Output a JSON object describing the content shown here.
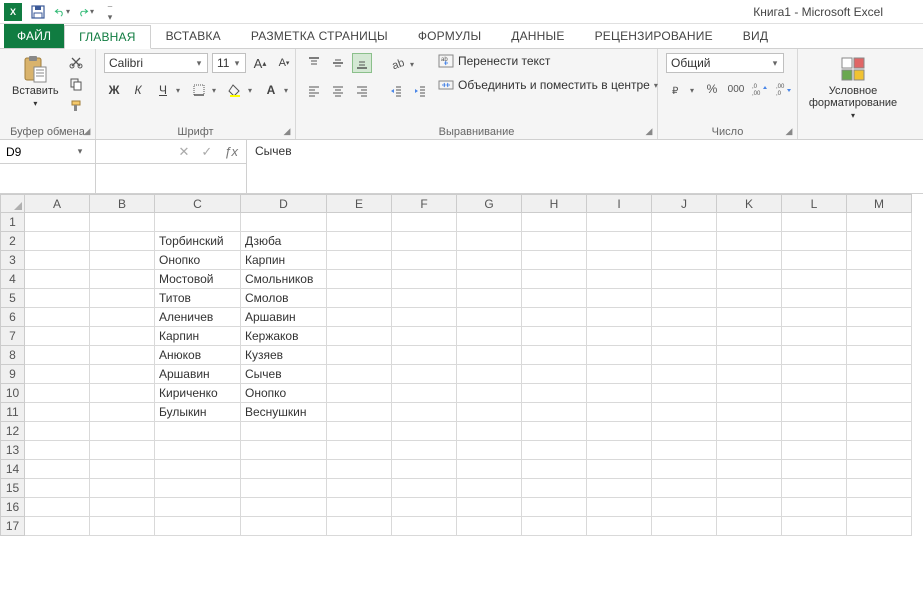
{
  "app": {
    "title": "Книга1 - Microsoft Excel"
  },
  "qat": {
    "save": "save-icon",
    "undo": "undo-icon",
    "redo": "redo-icon"
  },
  "tabs": {
    "file": "ФАЙЛ",
    "items": [
      "ГЛАВНАЯ",
      "ВСТАВКА",
      "РАЗМЕТКА СТРАНИЦЫ",
      "ФОРМУЛЫ",
      "ДАННЫЕ",
      "РЕЦЕНЗИРОВАНИЕ",
      "ВИД"
    ],
    "active_index": 0
  },
  "ribbon": {
    "clipboard": {
      "label": "Буфер обмена",
      "paste": "Вставить"
    },
    "font": {
      "label": "Шрифт",
      "name": "Calibri",
      "size": "11"
    },
    "alignment": {
      "label": "Выравнивание",
      "wrap": "Перенести текст",
      "merge": "Объединить и поместить в центре"
    },
    "number": {
      "label": "Число",
      "format": "Общий"
    },
    "styles": {
      "label": "Условное",
      "label2": "форматирование"
    }
  },
  "namebox": {
    "value": "D9"
  },
  "formula": {
    "value": "Сычев"
  },
  "columns": [
    "A",
    "B",
    "C",
    "D",
    "E",
    "F",
    "G",
    "H",
    "I",
    "J",
    "K",
    "L",
    "M"
  ],
  "rows": 17,
  "cells": {
    "C2": "Торбинский",
    "D2": "Дзюба",
    "C3": "Онопко",
    "D3": "Карпин",
    "C4": "Мостовой",
    "D4": "Смольников",
    "C5": "Титов",
    "D5": "Смолов",
    "C6": "Аленичев",
    "D6": "Аршавин",
    "C7": "Карпин",
    "D7": "Кержаков",
    "C8": "Анюков",
    "D8": "Кузяев",
    "C9": "Аршавин",
    "D9": "Сычев",
    "C10": "Кириченко",
    "D10": "Онопко",
    "C11": "Булыкин",
    "D11": "Веснушкин"
  }
}
